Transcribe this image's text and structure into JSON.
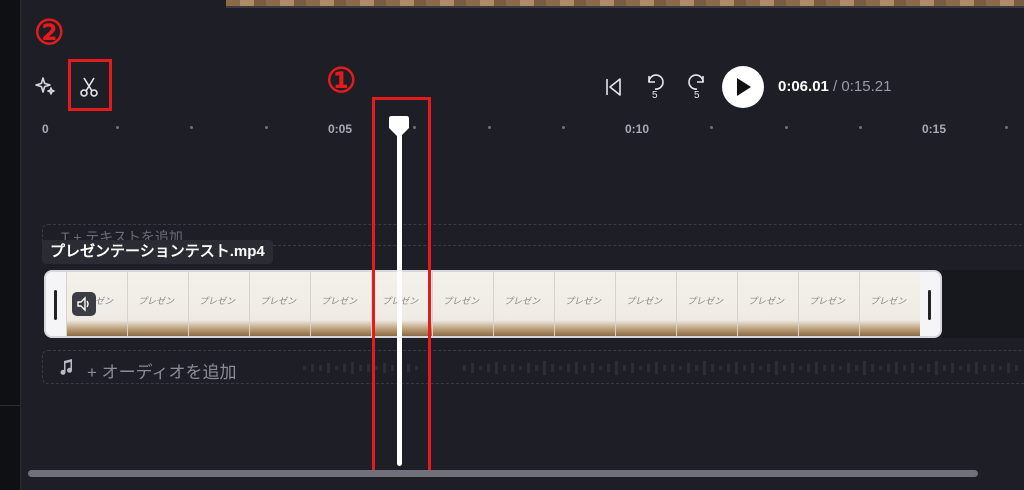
{
  "annotations": {
    "marker_1": "①",
    "marker_2": "②"
  },
  "player": {
    "current_time": "0:06.01",
    "separator": "/",
    "total_time": "0:15.21"
  },
  "ruler": {
    "labels": [
      "0",
      "0:05",
      "0:10",
      "0:15"
    ]
  },
  "tracks": {
    "text_placeholder": "T  + テキストを追加",
    "video_clip_name": "プレゼンテーションテスト.mp4",
    "thumbnail_text": "プレゼン",
    "audio_placeholder": "+ オーディオを追加"
  },
  "colors": {
    "annotation": "#e41b1b",
    "background": "#1e1f26",
    "playhead": "#ffffff"
  },
  "icons": [
    "sparkle-icon",
    "scissors-icon",
    "skip-to-start-icon",
    "rewind-5-icon",
    "forward-5-icon",
    "play-icon",
    "volume-icon",
    "music-note-icon"
  ]
}
